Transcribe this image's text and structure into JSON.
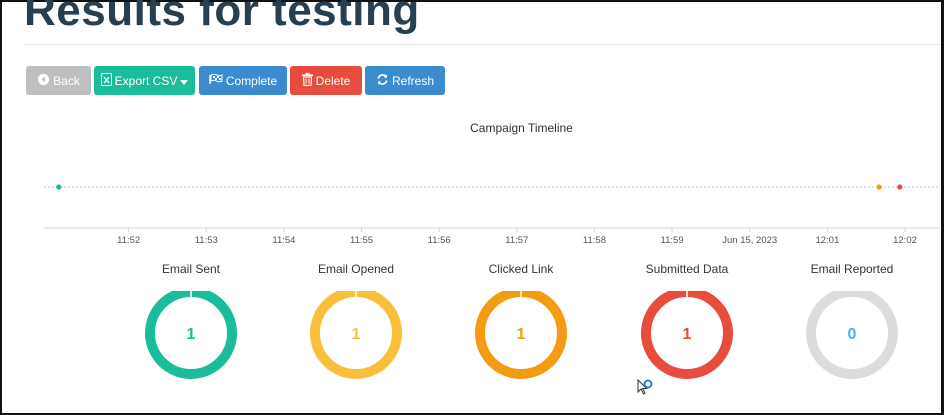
{
  "page": {
    "title": "Results for testing"
  },
  "toolbar": {
    "back": "Back",
    "export_csv": "Export CSV",
    "complete": "Complete",
    "delete": "Delete",
    "refresh": "Refresh",
    "colors": {
      "back": "#bdbfc1",
      "export": "#1abc9c",
      "complete": "#3b8ccf",
      "delete": "#e74c3c",
      "refresh": "#3b8ccf"
    }
  },
  "chart_data": {
    "type": "scatter",
    "title": "Campaign Timeline",
    "x_tick_labels": [
      "11:52",
      "11:53",
      "11:54",
      "11:55",
      "11:56",
      "11:57",
      "11:58",
      "11:59",
      "Jun 15, 2023",
      "12:01",
      "12:02"
    ],
    "x_range_minutes": [
      "11:51",
      "12:02"
    ],
    "points": [
      {
        "time": "11:51:06",
        "color": "#1abc9c"
      },
      {
        "time": "12:01:40",
        "color": "#f39c12"
      },
      {
        "time": "12:01:56",
        "color": "#e74c3c"
      }
    ]
  },
  "stats": [
    {
      "label": "Email Sent",
      "value": "1",
      "color": "#1abc9c",
      "fraction": 1
    },
    {
      "label": "Email Opened",
      "value": "1",
      "color": "#f9bf3b",
      "fraction": 1
    },
    {
      "label": "Clicked Link",
      "value": "1",
      "color": "#f39c12",
      "fraction": 1
    },
    {
      "label": "Submitted Data",
      "value": "1",
      "color": "#e74c3c",
      "fraction": 1
    },
    {
      "label": "Email Reported",
      "value": "0",
      "color": "#dcdcdc",
      "fraction": 0,
      "value_color": "#3db6e0"
    }
  ]
}
